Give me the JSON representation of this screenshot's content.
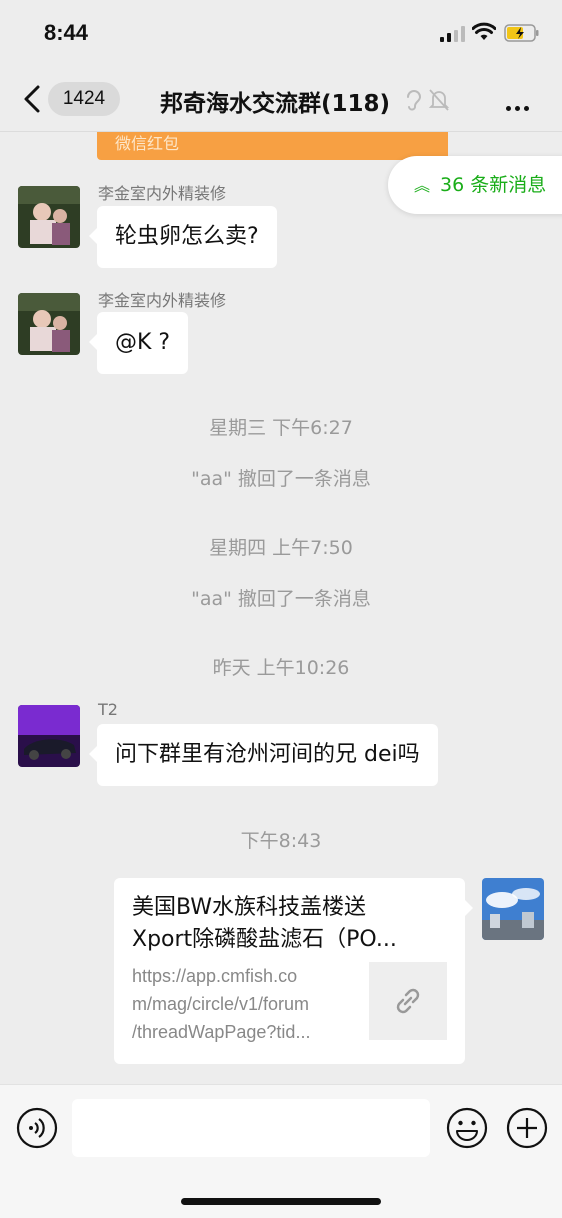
{
  "status_bar": {
    "time": "8:44"
  },
  "header": {
    "unread_count": "1424",
    "title": "邦奇海水交流群(118)"
  },
  "red_packet_label": "微信红包",
  "new_messages_label": "36 条新消息",
  "messages": [
    {
      "sender": "李金室内外精装修",
      "text": "轮虫卵怎么卖?"
    },
    {
      "sender": "李金室内外精装修",
      "text": "@K ?"
    },
    {
      "sender": "T2",
      "text": "问下群里有沧州河间的兄 dei吗"
    }
  ],
  "system_lines": [
    "星期三 下午6:27",
    "\"aa\" 撤回了一条消息",
    "星期四 上午7:50",
    "\"aa\" 撤回了一条消息",
    "昨天 上午10:26",
    "下午8:43"
  ],
  "link_card": {
    "title_line1": "美国BW水族科技盖楼送",
    "title_line2": "Xport除磷酸盐滤石（PO...",
    "desc_line1": "https://app.cmfish.co",
    "desc_line2": "m/mag/circle/v1/forum",
    "desc_line3": "/threadWapPage?tid..."
  },
  "colors": {
    "accent_green": "#1aad19",
    "red_packet": "#f7a043",
    "background": "#ededed"
  }
}
